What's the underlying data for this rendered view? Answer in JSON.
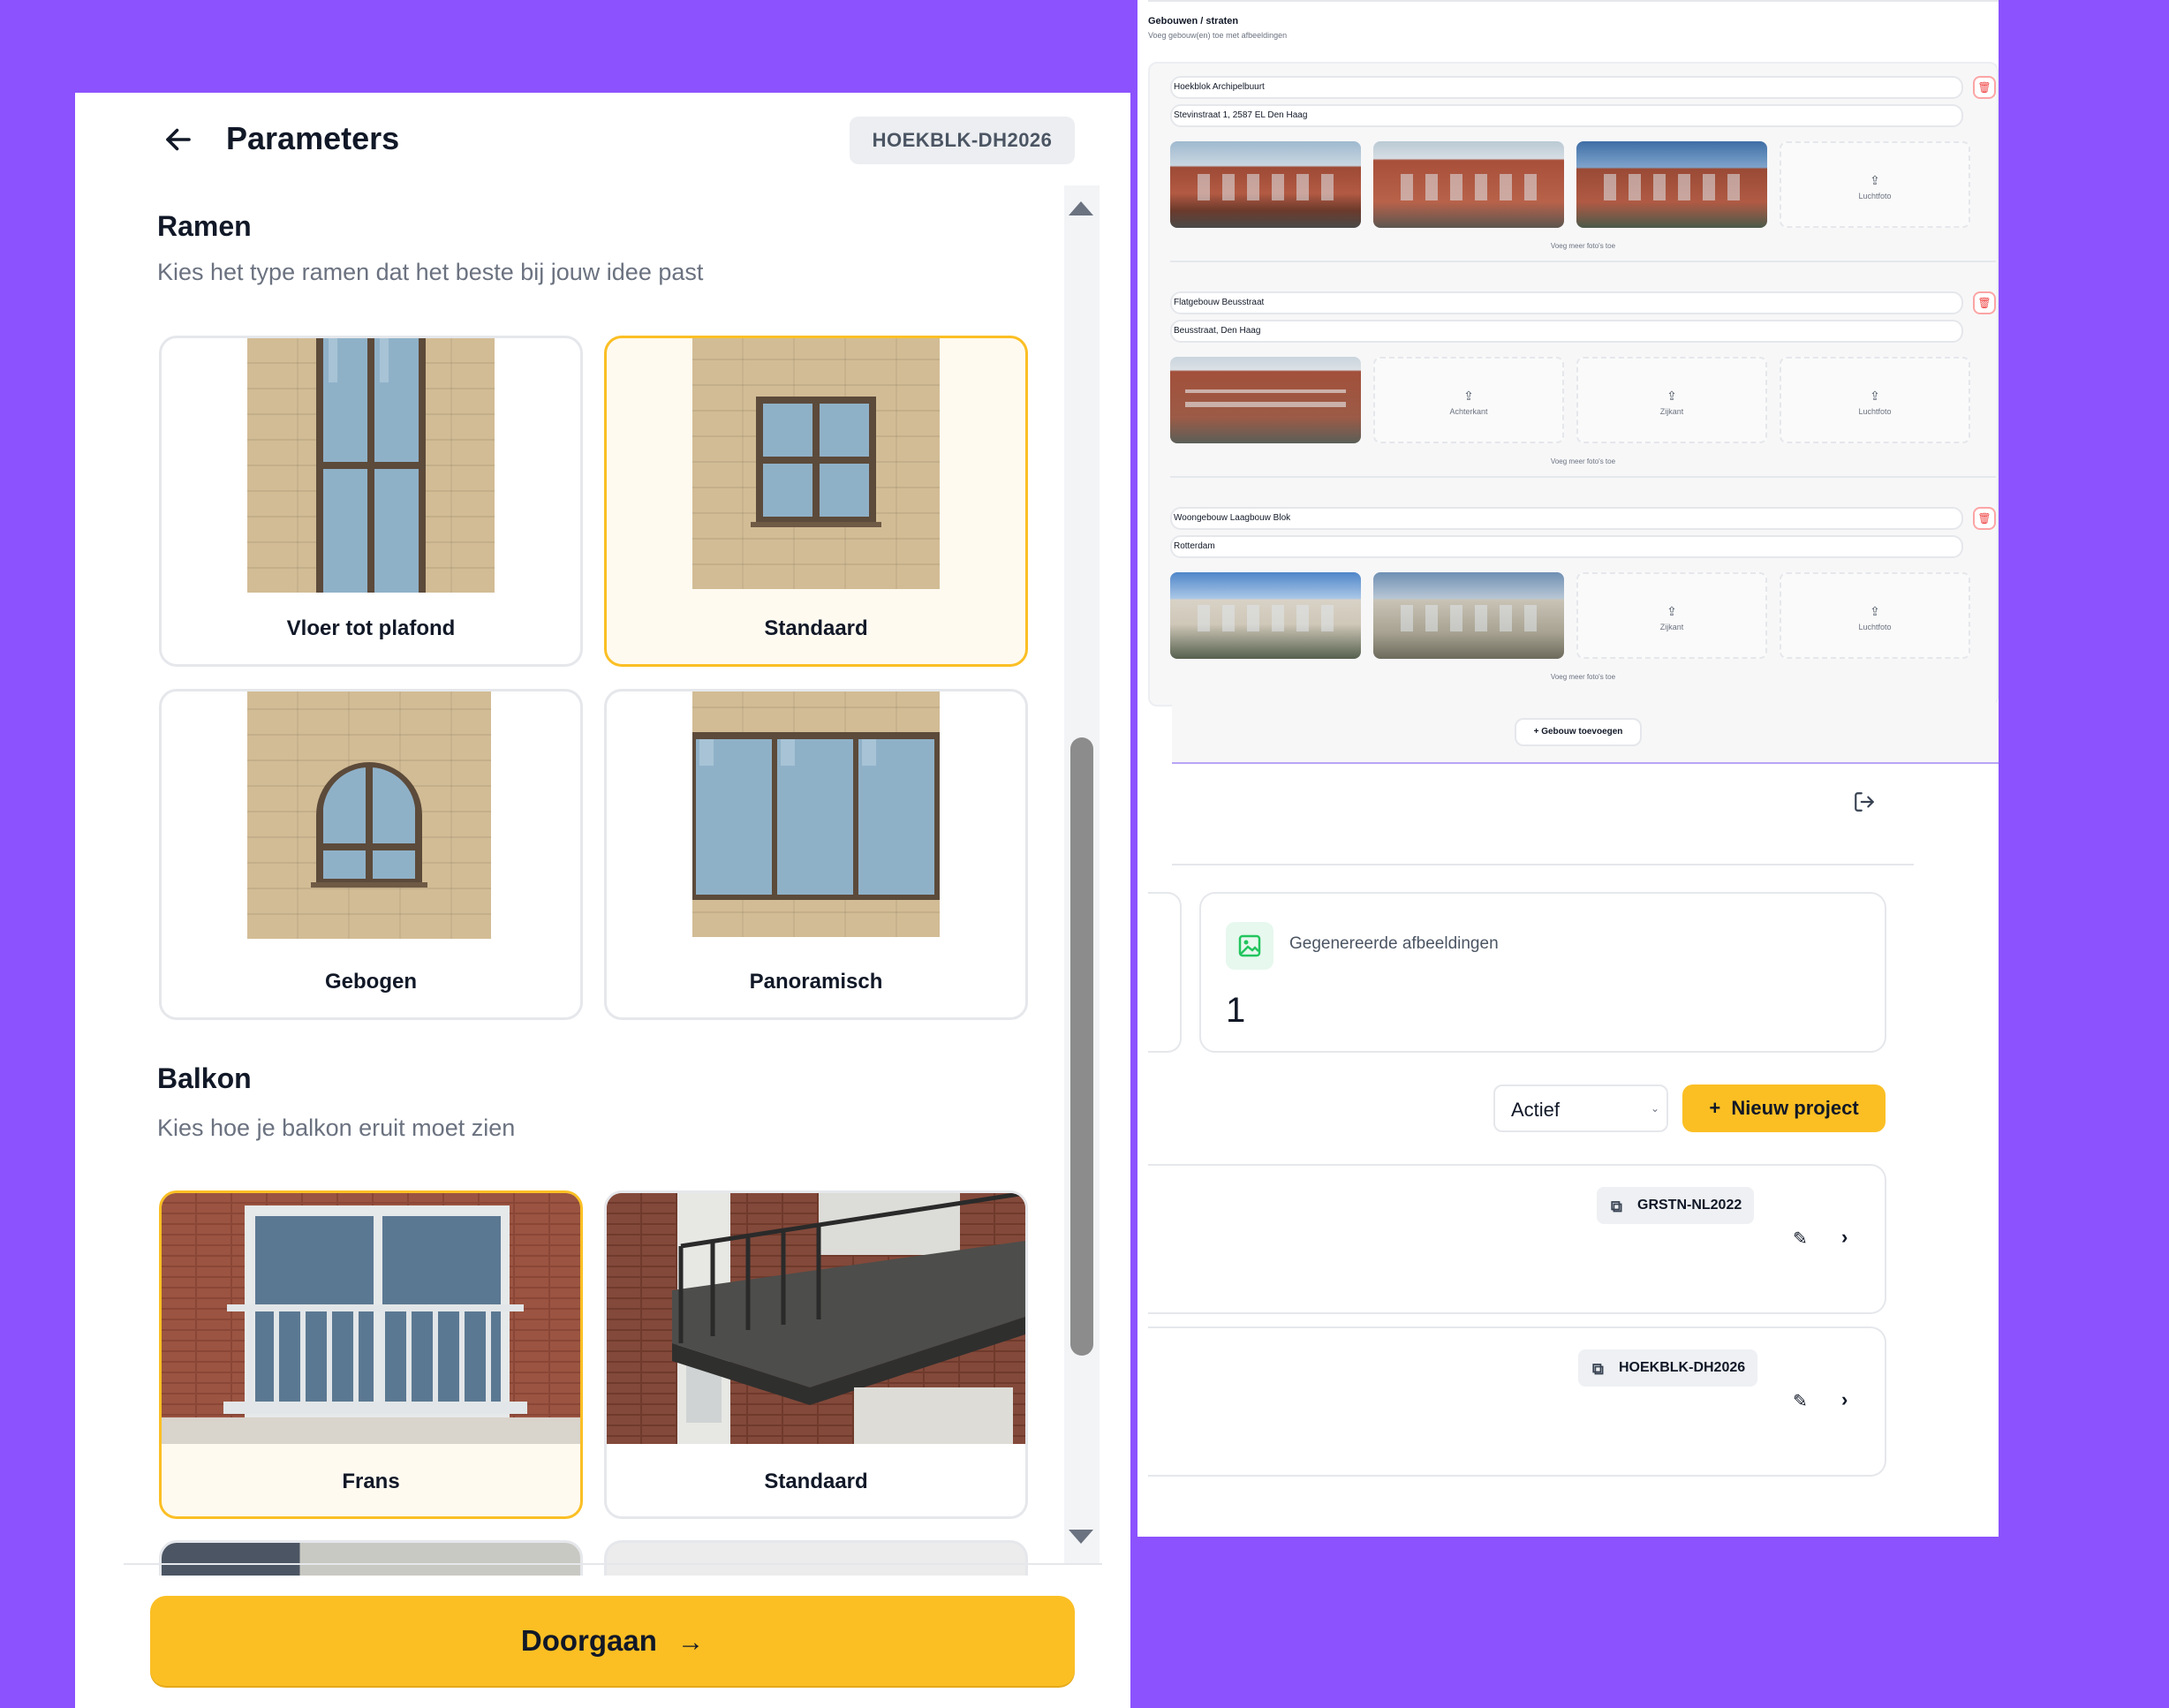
{
  "modal": {
    "title": "Parameters",
    "project_code": "HOEKBLK-DH2026",
    "ramen": {
      "title": "Ramen",
      "subtitle": "Kies het type ramen dat het beste bij jouw idee past",
      "options": [
        {
          "label": "Vloer tot plafond",
          "selected": false
        },
        {
          "label": "Standaard",
          "selected": true
        },
        {
          "label": "Gebogen",
          "selected": false
        },
        {
          "label": "Panoramisch",
          "selected": false
        }
      ]
    },
    "balkon": {
      "title": "Balkon",
      "subtitle": "Kies hoe je balkon eruit moet zien",
      "options": [
        {
          "label": "Frans",
          "selected": true
        },
        {
          "label": "Standaard",
          "selected": false
        }
      ]
    },
    "continue_label": "Doorgaan"
  },
  "dashboard": {
    "gebouwen": {
      "title": "Gebouwen / straten",
      "subtitle": "Voeg gebouw(en) toe met afbeeldingen",
      "buildings": [
        {
          "name": "Hoekblok Archipelbuurt",
          "address": "Stevinstraat 1, 2587 EL Den Haag",
          "placeholders": [
            "Luchtfoto"
          ],
          "more": "Voeg meer foto's toe"
        },
        {
          "name": "Flatgebouw Beusstraat",
          "address": "Beusstraat, Den Haag",
          "placeholders": [
            "Achterkant",
            "Zijkant",
            "Luchtfoto"
          ],
          "more": "Voeg meer foto's toe"
        },
        {
          "name": "Woongebouw Laagbouw Blok",
          "address": "Rotterdam",
          "placeholders": [
            "Zijkant",
            "Luchtfoto"
          ],
          "more": "Voeg meer foto's toe"
        }
      ],
      "add_label": "Gebouw toevoegen"
    },
    "stats": {
      "label": "Gegenereerde afbeeldingen",
      "value": "1"
    },
    "filter": {
      "selected": "Actief"
    },
    "new_project_label": "Nieuw project",
    "projects": [
      {
        "code": "GRSTN-NL2022"
      },
      {
        "code": "HOEKBLK-DH2026"
      }
    ]
  },
  "colors": {
    "background": "#8b52fe",
    "accent": "#fbbf24",
    "window_frame": "#5c4a3a",
    "glass": "#8fb1c8",
    "wall": "#d2bc95"
  }
}
